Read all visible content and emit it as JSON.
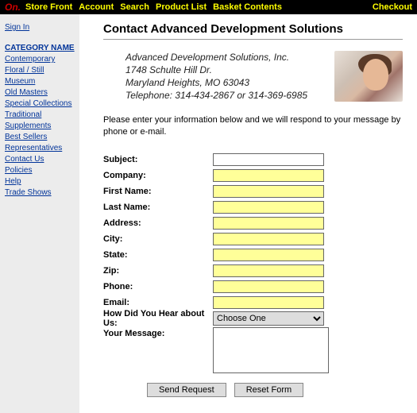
{
  "topbar": {
    "logo": "On.",
    "items": [
      "Store Front",
      "Account",
      "Search",
      "Product List",
      "Basket Contents"
    ],
    "checkout": "Checkout"
  },
  "sidebar": {
    "signin": "Sign In",
    "cat_title": "CATEGORY  NAME",
    "categories": [
      "Contemporary",
      "Floral / Still",
      "Museum",
      "Old Masters",
      "Special Collections",
      "Traditional",
      "Supplements",
      "Best Sellers",
      "Representatives",
      "Contact Us",
      "Policies",
      "Help",
      "Trade Shows"
    ]
  },
  "main": {
    "title": "Contact Advanced Development Solutions",
    "company": {
      "name": "Advanced Development Solutions, Inc.",
      "addr1": "1748 Schulte Hill Dr.",
      "addr2": "Maryland Heights, MO 63043",
      "tel": "Telephone: 314-434-2867 or 314-369-6985"
    },
    "intro": "Please enter your information below and we will respond to your message by phone or e-mail.",
    "labels": {
      "subject": "Subject:",
      "company": "Company:",
      "first": "First Name:",
      "last": "Last Name:",
      "address": "Address:",
      "city": "City:",
      "state": "State:",
      "zip": "Zip:",
      "phone": "Phone:",
      "email": "Email:",
      "hear": "How Did You Hear about Us:",
      "msg": "Your Message:"
    },
    "hear_selected": "Choose One",
    "buttons": {
      "send": "Send Request",
      "reset": "Reset Form"
    }
  }
}
